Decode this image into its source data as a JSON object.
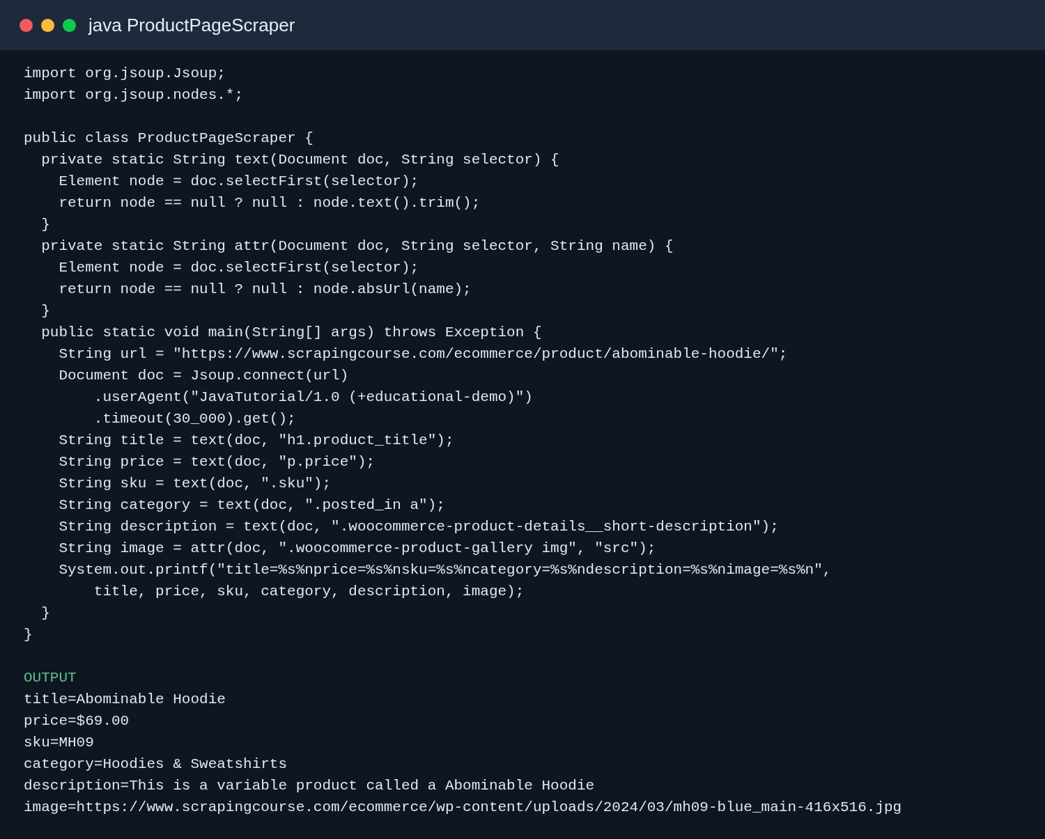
{
  "window": {
    "title": "java ProductPageScraper"
  },
  "code_blocks": [
    [
      "import org.jsoup.Jsoup;",
      "import org.jsoup.nodes.*;"
    ],
    [
      "public class ProductPageScraper {",
      "  private static String text(Document doc, String selector) {",
      "    Element node = doc.selectFirst(selector);",
      "    return node == null ? null : node.text().trim();",
      "  }",
      "  private static String attr(Document doc, String selector, String name) {",
      "    Element node = doc.selectFirst(selector);",
      "    return node == null ? null : node.absUrl(name);",
      "  }",
      "  public static void main(String[] args) throws Exception {",
      "    String url = \"https://www.scrapingcourse.com/ecommerce/product/abominable-hoodie/\";",
      "    Document doc = Jsoup.connect(url)",
      "        .userAgent(\"JavaTutorial/1.0 (+educational-demo)\")",
      "        .timeout(30_000).get();",
      "    String title = text(doc, \"h1.product_title\");",
      "    String price = text(doc, \"p.price\");",
      "    String sku = text(doc, \".sku\");",
      "    String category = text(doc, \".posted_in a\");",
      "    String description = text(doc, \".woocommerce-product-details__short-description\");",
      "    String image = attr(doc, \".woocommerce-product-gallery img\", \"src\");",
      "    System.out.printf(\"title=%s%nprice=%s%nsku=%s%ncategory=%s%ndescription=%s%nimage=%s%n\",",
      "        title, price, sku, category, description, image);",
      "  }",
      "}"
    ]
  ],
  "output": {
    "label": "OUTPUT",
    "lines": [
      "title=Abominable Hoodie",
      "price=$69.00",
      "sku=MH09",
      "category=Hoodies & Sweatshirts",
      "description=This is a variable product called a Abominable Hoodie",
      "image=https://www.scrapingcourse.com/ecommerce/wp-content/uploads/2024/03/mh09-blue_main-416x516.jpg"
    ]
  }
}
